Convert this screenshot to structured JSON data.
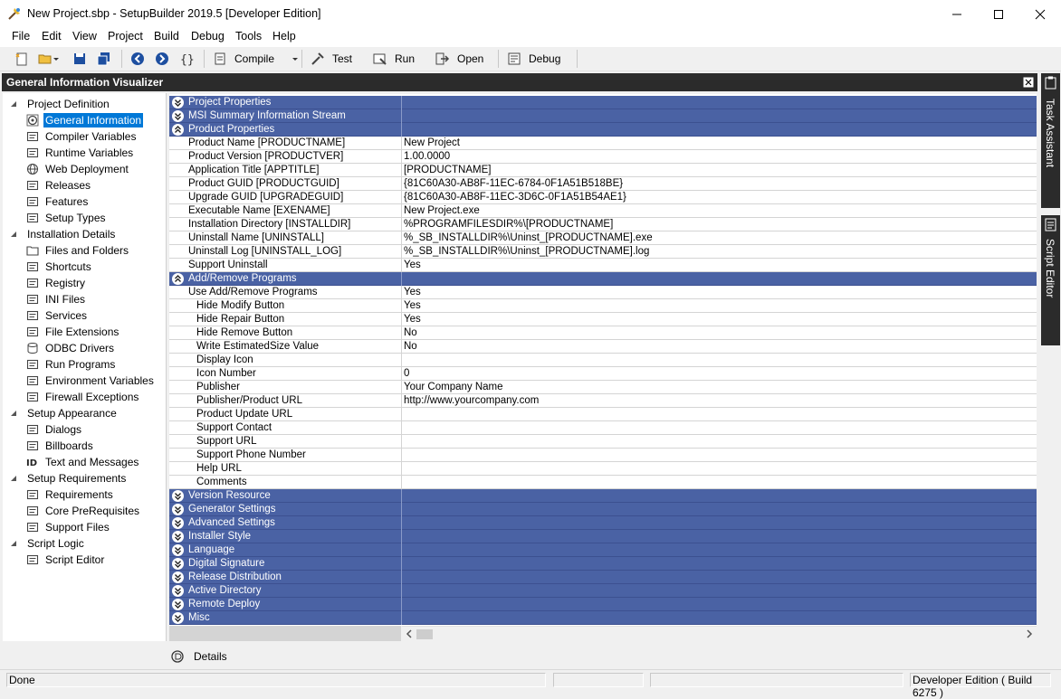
{
  "window": {
    "title": "New Project.sbp - SetupBuilder 2019.5 [Developer Edition]"
  },
  "menu": [
    "File",
    "Edit",
    "View",
    "Project",
    "Build",
    "Debug",
    "Tools",
    "Help"
  ],
  "toolbar": {
    "compile": "Compile",
    "test": "Test",
    "run": "Run",
    "open": "Open",
    "debug": "Debug"
  },
  "panel": {
    "title": "General Information Visualizer"
  },
  "tree": [
    {
      "label": "Project Definition",
      "icon": "collapse-icon",
      "level": 0
    },
    {
      "label": "General Information",
      "icon": "gear-icon",
      "level": 1,
      "selected": true
    },
    {
      "label": "Compiler Variables",
      "icon": "variables-icon",
      "level": 1
    },
    {
      "label": "Runtime Variables",
      "icon": "runtime-icon",
      "level": 1
    },
    {
      "label": "Web Deployment",
      "icon": "globe-icon",
      "level": 1
    },
    {
      "label": "Releases",
      "icon": "releases-icon",
      "level": 1
    },
    {
      "label": "Features",
      "icon": "features-icon",
      "level": 1
    },
    {
      "label": "Setup Types",
      "icon": "setup-types-icon",
      "level": 1
    },
    {
      "label": "Installation Details",
      "icon": "collapse-icon",
      "level": 0
    },
    {
      "label": "Files and Folders",
      "icon": "folder-icon",
      "level": 1
    },
    {
      "label": "Shortcuts",
      "icon": "shortcut-icon",
      "level": 1
    },
    {
      "label": "Registry",
      "icon": "registry-icon",
      "level": 1
    },
    {
      "label": "INI Files",
      "icon": "ini-icon",
      "level": 1
    },
    {
      "label": "Services",
      "icon": "services-icon",
      "level": 1
    },
    {
      "label": "File Extensions",
      "icon": "file-ext-icon",
      "level": 1
    },
    {
      "label": "ODBC Drivers",
      "icon": "database-icon",
      "level": 1
    },
    {
      "label": "Run Programs",
      "icon": "run-programs-icon",
      "level": 1
    },
    {
      "label": "Environment Variables",
      "icon": "env-icon",
      "level": 1
    },
    {
      "label": "Firewall Exceptions",
      "icon": "firewall-icon",
      "level": 1
    },
    {
      "label": "Setup Appearance",
      "icon": "collapse-icon",
      "level": 0
    },
    {
      "label": "Dialogs",
      "icon": "dialog-icon",
      "level": 1
    },
    {
      "label": "Billboards",
      "icon": "billboard-icon",
      "level": 1
    },
    {
      "label": "Text and Messages",
      "icon": "text-icon",
      "level": 1
    },
    {
      "label": "Setup Requirements",
      "icon": "collapse-icon",
      "level": 0
    },
    {
      "label": "Requirements",
      "icon": "requirements-icon",
      "level": 1
    },
    {
      "label": "Core PreRequisites",
      "icon": "prereq-icon",
      "level": 1
    },
    {
      "label": "Support Files",
      "icon": "support-files-icon",
      "level": 1
    },
    {
      "label": "Script Logic",
      "icon": "collapse-icon",
      "level": 0
    },
    {
      "label": "Script Editor",
      "icon": "script-icon",
      "level": 1
    }
  ],
  "grid": [
    {
      "type": "cat",
      "label": "Project Properties",
      "expanded": false
    },
    {
      "type": "cat",
      "label": "MSI Summary Information Stream",
      "expanded": false
    },
    {
      "type": "cat",
      "label": "Product Properties",
      "expanded": true
    },
    {
      "type": "prop",
      "name": "Product Name  [PRODUCTNAME]",
      "value": "New Project",
      "indent": 1
    },
    {
      "type": "prop",
      "name": "Product Version  [PRODUCTVER]",
      "value": "1.00.0000",
      "indent": 1
    },
    {
      "type": "prop",
      "name": "Application Title  [APPTITLE]",
      "value": "[PRODUCTNAME]",
      "indent": 1
    },
    {
      "type": "prop",
      "name": "Product GUID  [PRODUCTGUID]",
      "value": "{81C60A30-AB8F-11EC-6784-0F1A51B518BE}",
      "indent": 1
    },
    {
      "type": "prop",
      "name": "Upgrade GUID  [UPGRADEGUID]",
      "value": "{81C60A30-AB8F-11EC-3D6C-0F1A51B54AE1}",
      "indent": 1
    },
    {
      "type": "prop",
      "name": "Executable Name  [EXENAME]",
      "value": "New Project.exe",
      "indent": 1
    },
    {
      "type": "prop",
      "name": "Installation Directory  [INSTALLDIR]",
      "value": "%PROGRAMFILESDIR%\\[PRODUCTNAME]",
      "indent": 1
    },
    {
      "type": "prop",
      "name": "Uninstall Name  [UNINSTALL]",
      "value": "%_SB_INSTALLDIR%\\Uninst_[PRODUCTNAME].exe",
      "indent": 1
    },
    {
      "type": "prop",
      "name": "Uninstall Log  [UNINSTALL_LOG]",
      "value": "%_SB_INSTALLDIR%\\Uninst_[PRODUCTNAME].log",
      "indent": 1
    },
    {
      "type": "prop",
      "name": "Support Uninstall",
      "value": "Yes",
      "indent": 1
    },
    {
      "type": "cat",
      "label": "Add/Remove Programs",
      "expanded": true
    },
    {
      "type": "prop",
      "name": "Use Add/Remove Programs",
      "value": "Yes",
      "indent": 1
    },
    {
      "type": "prop",
      "name": "Hide Modify Button",
      "value": "Yes",
      "indent": 2
    },
    {
      "type": "prop",
      "name": "Hide Repair Button",
      "value": "Yes",
      "indent": 2
    },
    {
      "type": "prop",
      "name": "Hide Remove Button",
      "value": "No",
      "indent": 2
    },
    {
      "type": "prop",
      "name": "Write EstimatedSize Value",
      "value": "No",
      "indent": 2
    },
    {
      "type": "prop",
      "name": "Display Icon",
      "value": "",
      "indent": 2
    },
    {
      "type": "prop",
      "name": "Icon Number",
      "value": "0",
      "indent": 2
    },
    {
      "type": "prop",
      "name": "Publisher",
      "value": "Your Company Name",
      "indent": 2
    },
    {
      "type": "prop",
      "name": "Publisher/Product URL",
      "value": "http://www.yourcompany.com",
      "indent": 2
    },
    {
      "type": "prop",
      "name": "Product Update URL",
      "value": "",
      "indent": 2
    },
    {
      "type": "prop",
      "name": "Support Contact",
      "value": "",
      "indent": 2
    },
    {
      "type": "prop",
      "name": "Support URL",
      "value": "",
      "indent": 2
    },
    {
      "type": "prop",
      "name": "Support Phone Number",
      "value": "",
      "indent": 2
    },
    {
      "type": "prop",
      "name": "Help URL",
      "value": "",
      "indent": 2
    },
    {
      "type": "prop",
      "name": "Comments",
      "value": "",
      "indent": 2
    },
    {
      "type": "cat",
      "label": "Version Resource",
      "expanded": false
    },
    {
      "type": "cat",
      "label": "Generator Settings",
      "expanded": false
    },
    {
      "type": "cat",
      "label": "Advanced Settings",
      "expanded": false
    },
    {
      "type": "cat",
      "label": "Installer Style",
      "expanded": false
    },
    {
      "type": "cat",
      "label": "Language",
      "expanded": false
    },
    {
      "type": "cat",
      "label": "Digital Signature",
      "expanded": false
    },
    {
      "type": "cat",
      "label": "Release Distribution",
      "expanded": false
    },
    {
      "type": "cat",
      "label": "Active Directory",
      "expanded": false
    },
    {
      "type": "cat",
      "label": "Remote Deploy",
      "expanded": false
    },
    {
      "type": "cat",
      "label": "Misc",
      "expanded": false
    }
  ],
  "details": {
    "label": "Details"
  },
  "side_tabs": {
    "task_assistant": "Task Assistant",
    "script_editor": "Script Editor"
  },
  "status": {
    "left": "Done",
    "right": "Developer Edition ( Build 6275 )"
  },
  "colors": {
    "category_bg": "#4a62a4",
    "selection": "#0078d7",
    "panel_header": "#2b2b2b"
  }
}
